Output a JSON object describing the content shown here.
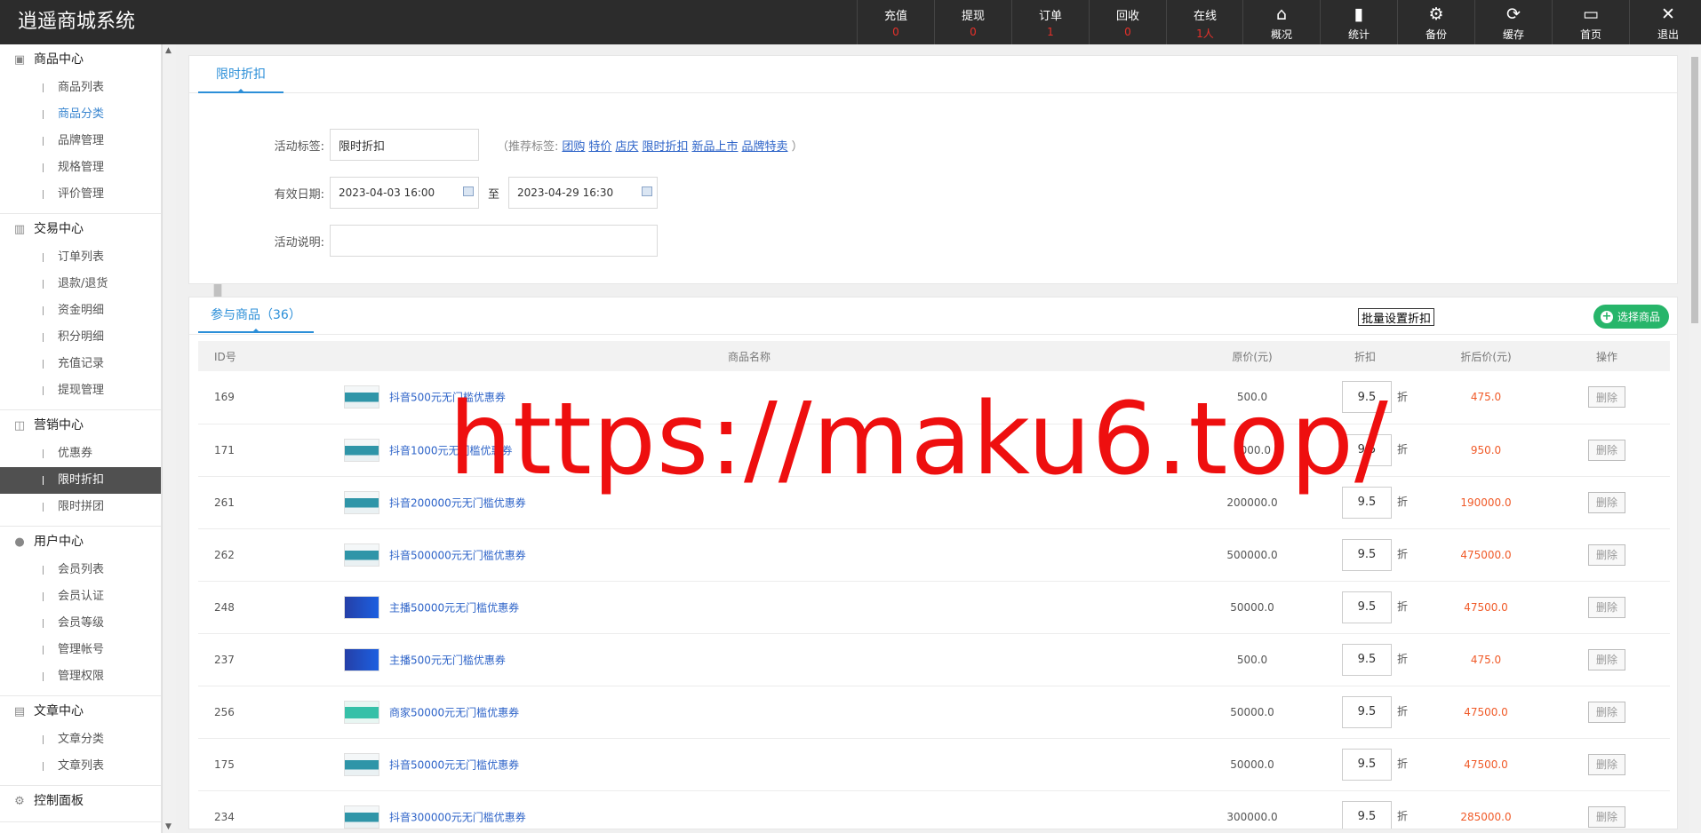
{
  "app": {
    "title": "逍遥商城系统"
  },
  "header": {
    "stats": [
      {
        "label": "充值",
        "value": "0"
      },
      {
        "label": "提现",
        "value": "0"
      },
      {
        "label": "订单",
        "value": "1"
      },
      {
        "label": "回收",
        "value": "0"
      },
      {
        "label": "在线",
        "value": "1人"
      }
    ],
    "tools": [
      {
        "label": "概况",
        "icon": "home-icon",
        "glyph": "⌂"
      },
      {
        "label": "统计",
        "icon": "bar-chart-icon",
        "glyph": "▮"
      },
      {
        "label": "备份",
        "icon": "gear-icon",
        "glyph": "⚙"
      },
      {
        "label": "缓存",
        "icon": "refresh-icon",
        "glyph": "⟳"
      },
      {
        "label": "首页",
        "icon": "monitor-icon",
        "glyph": "▭"
      },
      {
        "label": "退出",
        "icon": "close-icon",
        "glyph": "✕"
      }
    ]
  },
  "sidebar": {
    "groups": [
      {
        "title": "商品中心",
        "icon": "box-icon",
        "items": [
          "商品列表",
          "商品分类",
          "品牌管理",
          "规格管理",
          "评价管理"
        ]
      },
      {
        "title": "交易中心",
        "icon": "bar-chart-icon",
        "items": [
          "订单列表",
          "退款/退货",
          "资金明细",
          "积分明细",
          "充值记录",
          "提现管理"
        ]
      },
      {
        "title": "营销中心",
        "icon": "area-chart-icon",
        "items": [
          "优惠券",
          "限时折扣",
          "限时拼团"
        ]
      },
      {
        "title": "用户中心",
        "icon": "user-icon",
        "items": [
          "会员列表",
          "会员认证",
          "会员等级",
          "管理帐号",
          "管理权限"
        ]
      },
      {
        "title": "文章中心",
        "icon": "document-icon",
        "items": [
          "文章分类",
          "文章列表"
        ]
      },
      {
        "title": "控制面板",
        "icon": "gear-icon",
        "items": []
      }
    ]
  },
  "form": {
    "tab": "限时折扣",
    "tag_label": "活动标签:",
    "tag_value": "限时折扣",
    "recommend_prefix": "（推荐标签:",
    "recommend_suffix": "）",
    "recommend": [
      "团购",
      "特价",
      "店庆",
      "限时折扣",
      "新品上市",
      "品牌特卖"
    ],
    "date_label": "有效日期:",
    "date_start": "2023-04-03 16:00",
    "date_to": "至",
    "date_end": "2023-04-29 16:30",
    "desc_label": "活动说明:",
    "desc_value": ""
  },
  "goods": {
    "tab": "参与商品（36）",
    "batch_button": "批量设置折扣",
    "select_button": "选择商品",
    "columns": {
      "id": "ID号",
      "name": "商品名称",
      "price": "原价(元)",
      "discount": "折扣",
      "after": "折后价(元)",
      "op": "操作"
    },
    "unit": "折",
    "delete_label": "删除",
    "rows": [
      {
        "id": "169",
        "name": "抖音500元无门槛优惠券",
        "price": "500.0",
        "discount": "9.5",
        "after": "475.0",
        "thumb": "teal"
      },
      {
        "id": "171",
        "name": "抖音1000元无门槛优惠券",
        "price": "1000.0",
        "discount": "9.5",
        "after": "950.0",
        "thumb": "teal"
      },
      {
        "id": "261",
        "name": "抖音200000元无门槛优惠券",
        "price": "200000.0",
        "discount": "9.5",
        "after": "190000.0",
        "thumb": "teal"
      },
      {
        "id": "262",
        "name": "抖音500000元无门槛优惠券",
        "price": "500000.0",
        "discount": "9.5",
        "after": "475000.0",
        "thumb": "teal"
      },
      {
        "id": "248",
        "name": "主播50000元无门槛优惠券",
        "price": "50000.0",
        "discount": "9.5",
        "after": "47500.0",
        "thumb": "blue"
      },
      {
        "id": "237",
        "name": "主播500元无门槛优惠券",
        "price": "500.0",
        "discount": "9.5",
        "after": "475.0",
        "thumb": "blue"
      },
      {
        "id": "256",
        "name": "商家50000元无门槛优惠券",
        "price": "50000.0",
        "discount": "9.5",
        "after": "47500.0",
        "thumb": "cyan"
      },
      {
        "id": "175",
        "name": "抖音50000元无门槛优惠券",
        "price": "50000.0",
        "discount": "9.5",
        "after": "47500.0",
        "thumb": "teal"
      },
      {
        "id": "234",
        "name": "抖音300000元无门槛优惠券",
        "price": "300000.0",
        "discount": "9.5",
        "after": "285000.0",
        "thumb": "teal"
      }
    ]
  },
  "watermark": "https://maku6.top/"
}
